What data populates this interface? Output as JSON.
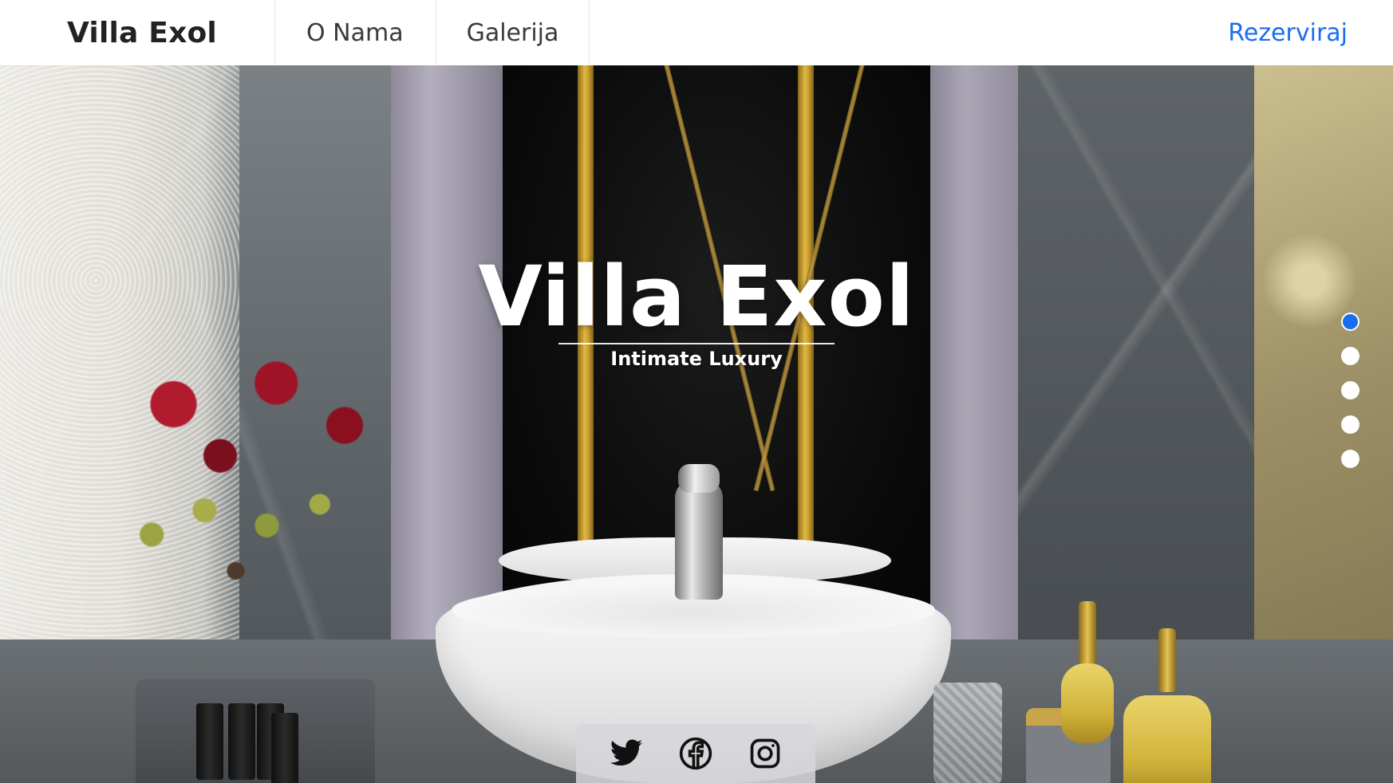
{
  "nav": {
    "brand": "Villa Exol",
    "links": [
      "O Nama",
      "Galerija"
    ],
    "cta": "Rezerviraj"
  },
  "hero": {
    "title": "Villa Exol",
    "subtitle": "Intimate Luxury",
    "background_description_colors": {
      "accent": "#1a6cf0"
    }
  },
  "slider": {
    "active_index": 0,
    "count": 5
  },
  "social": {
    "icons": [
      "twitter-icon",
      "facebook-icon",
      "instagram-icon"
    ]
  },
  "colors": {
    "accent": "#1a6cf0",
    "brand_text": "#222222",
    "nav_text": "#3a3a3a"
  }
}
